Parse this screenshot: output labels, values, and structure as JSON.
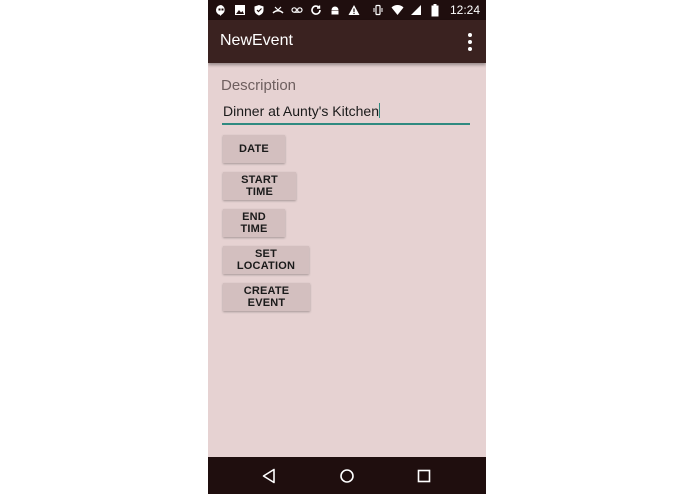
{
  "status_bar": {
    "time": "12:24",
    "icons_left": [
      "hangouts-icon",
      "image-icon",
      "shield-icon",
      "missed-call-icon",
      "voicemail-icon",
      "sync-icon",
      "android-icon",
      "warning-icon"
    ],
    "icons_right": [
      "vibrate-icon",
      "wifi-icon",
      "signal-icon",
      "battery-icon"
    ]
  },
  "app_bar": {
    "title": "NewEvent",
    "menu_icon": "more-vert-icon"
  },
  "form": {
    "description_label": "Description",
    "description_value": "Dinner at Aunty's Kitchen",
    "buttons": {
      "date": "DATE",
      "start_time": "START TIME",
      "end_time": "END TIME",
      "set_location": "SET LOCATION",
      "create_event": "CREATE EVENT"
    }
  },
  "nav_bar": {
    "icons": [
      "back-icon",
      "home-icon",
      "recents-icon"
    ]
  },
  "colors": {
    "status_bar": "#1f0e0e",
    "app_bar": "#3a2220",
    "background": "#e6d2d2",
    "button": "#d3bfbf",
    "accent": "#2f8a80"
  }
}
